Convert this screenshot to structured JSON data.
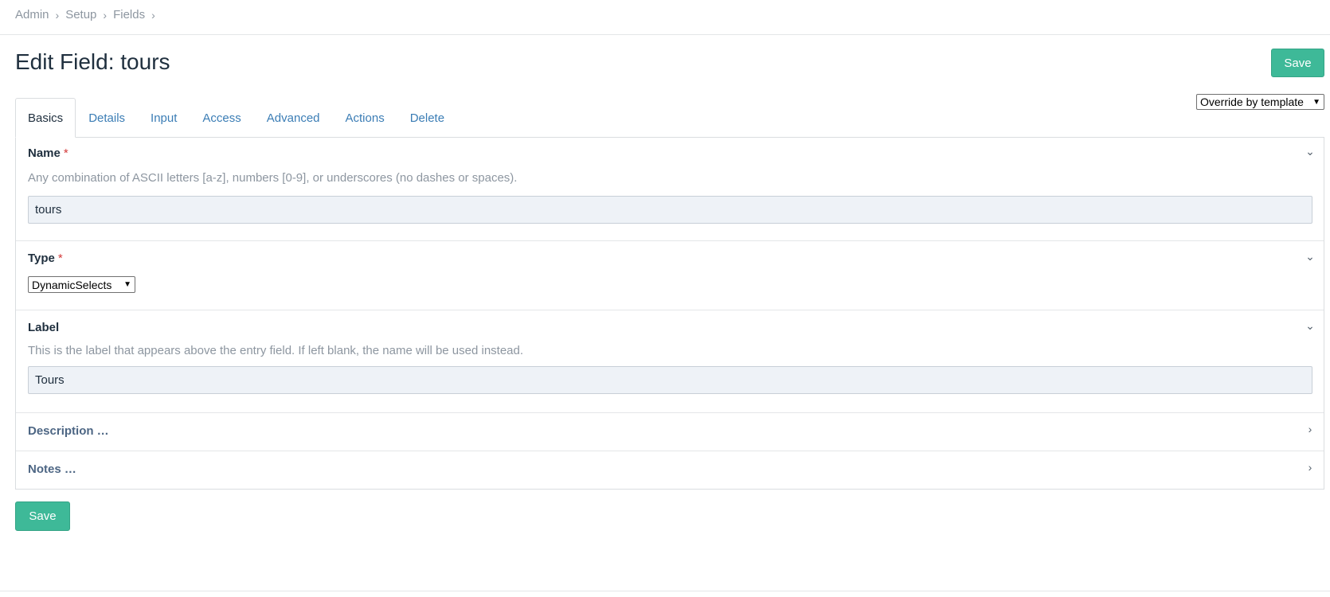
{
  "breadcrumb": [
    "Admin",
    "Setup",
    "Fields"
  ],
  "breadcrumb_separator": "›",
  "page_title": "Edit Field: tours",
  "save_label": "Save",
  "template_select": {
    "value": "Override by template",
    "arrow": "▼"
  },
  "tabs": [
    "Basics",
    "Details",
    "Input",
    "Access",
    "Advanced",
    "Actions",
    "Delete"
  ],
  "active_tab": "Basics",
  "sections": {
    "name": {
      "title": "Name",
      "required": "*",
      "notes": "Any combination of ASCII letters [a-z], numbers [0-9], or underscores (no dashes or spaces).",
      "value": "tours",
      "toggle": "⌄"
    },
    "type": {
      "title": "Type",
      "required": "*",
      "value": "DynamicSelects",
      "arrow": "▼",
      "toggle": "⌄"
    },
    "label": {
      "title": "Label",
      "notes": "This is the label that appears above the entry field. If left blank, the name will be used instead.",
      "value": "Tours",
      "toggle": "⌄"
    },
    "description": {
      "title": "Description …",
      "toggle": "›"
    },
    "notes": {
      "title": "Notes …",
      "toggle": "›"
    }
  },
  "colors": {
    "accent_green": "#3eb998",
    "link_blue": "#3b7db5",
    "required_red": "#d33a3a",
    "input_bg": "#eef2f7"
  }
}
